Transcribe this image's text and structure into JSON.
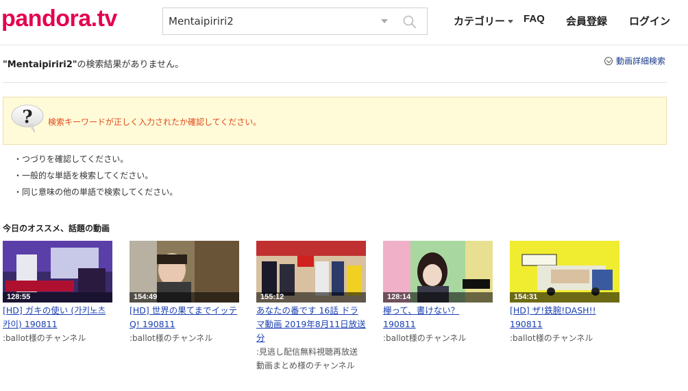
{
  "header": {
    "logo": "pandora.tv",
    "search_value": "Mentaipiriri2",
    "nav": {
      "category": "カテゴリー",
      "faq": "FAQ",
      "register": "会員登録",
      "login": "ログイン"
    }
  },
  "result": {
    "query": "\"Mentaipiriri2\"",
    "message": "の検索結果がありません。",
    "advanced_search": "動画詳細検索"
  },
  "notice": {
    "text": "検索キーワードが正しく入力されたか確認してください。"
  },
  "tips": [
    "・つづりを確認してください。",
    "・一般的な単語を検索してください。",
    "・同じ意味の他の単語で検索してください。"
  ],
  "recommendations": {
    "title": "今日のオススメ、話題の動画",
    "videos": [
      {
        "duration": "128:55",
        "title": "[HD] ガキの使い (가키노츠카이) 190811",
        "channel": ":ballot様のチャンネル"
      },
      {
        "duration": "154:49",
        "title": "[HD] 世界の果てまでイッテQ! 190811",
        "channel": ":ballot様のチャンネル"
      },
      {
        "duration": "155:12",
        "title": "あなたの番です 16話 ドラマ動画 2019年8月11日放送分",
        "channel": ":見逃し配信無料視聴再放送動画まとめ様のチャンネル"
      },
      {
        "duration": "128:14",
        "title": "欅って、書けない？ 190811",
        "channel": ":ballot様のチャンネル"
      },
      {
        "duration": "154:31",
        "title": "[HD] ザ!鉄腕!DASH!! 190811",
        "channel": ":ballot様のチャンネル"
      }
    ]
  },
  "colors": {
    "brand": "#e5004f",
    "link": "#1a3fb0",
    "notice_bg": "#fffbd9",
    "notice_text": "#e04a1a"
  }
}
